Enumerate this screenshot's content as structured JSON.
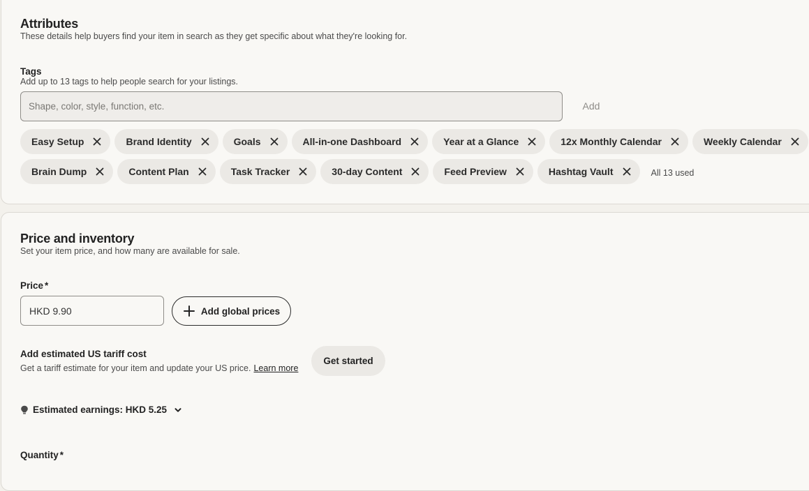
{
  "attributes": {
    "title": "Attributes",
    "subtitle": "These details help buyers find your item in search as they get specific about what they're looking for."
  },
  "tags": {
    "label": "Tags",
    "help": "Add up to 13 tags to help people search for your listings.",
    "placeholder": "Shape, color, style, function, etc.",
    "add_label": "Add",
    "items_row1": [
      "Easy Setup",
      "Brand Identity",
      "Goals",
      "All-in-one Dashboard",
      "Year at a Glance",
      "12x Monthly Calendar",
      "Weekly Calendar"
    ],
    "items_row2": [
      "Brain Dump",
      "Content Plan",
      "Task Tracker",
      "30-day Content",
      "Feed Preview",
      "Hashtag Vault"
    ],
    "used_label": "All 13 used"
  },
  "price_inventory": {
    "title": "Price and inventory",
    "subtitle": "Set your item price, and how many are available for sale."
  },
  "price": {
    "label": "Price",
    "required_mark": "*",
    "value": "HKD 9.90",
    "global_button": "Add global prices"
  },
  "tariff": {
    "title": "Add estimated US tariff cost",
    "help": "Get a tariff estimate for your item and update your US price.",
    "learn_more": "Learn more",
    "button": "Get started"
  },
  "earnings": {
    "label": "Estimated earnings: HKD 5.25",
    "icon": "lightbulb-icon"
  },
  "quantity": {
    "label": "Quantity",
    "required_mark": "*"
  },
  "colors": {
    "page_bg": "#f3f1ec",
    "card_bg": "#f9f8f5",
    "chip_bg": "#ebe9e5",
    "border": "#8f8d89",
    "text": "#222222"
  }
}
